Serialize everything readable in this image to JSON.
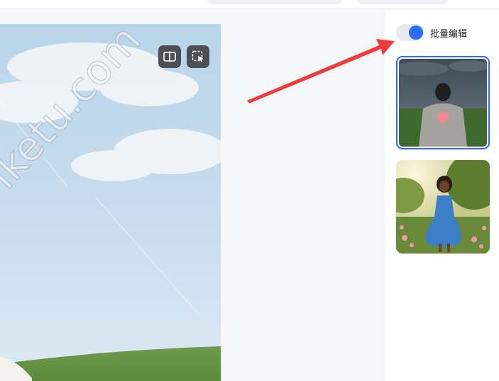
{
  "sidebar": {
    "batch_edit_label": "批量编辑",
    "batch_edit_on": true
  },
  "toolbar": {
    "compare_icon": "split-compare-icon",
    "select_icon": "cursor-select-icon"
  },
  "watermark_text": "iketu.com",
  "colors": {
    "accent": "#2b6cf6",
    "arrow": "#ef3b3b"
  }
}
